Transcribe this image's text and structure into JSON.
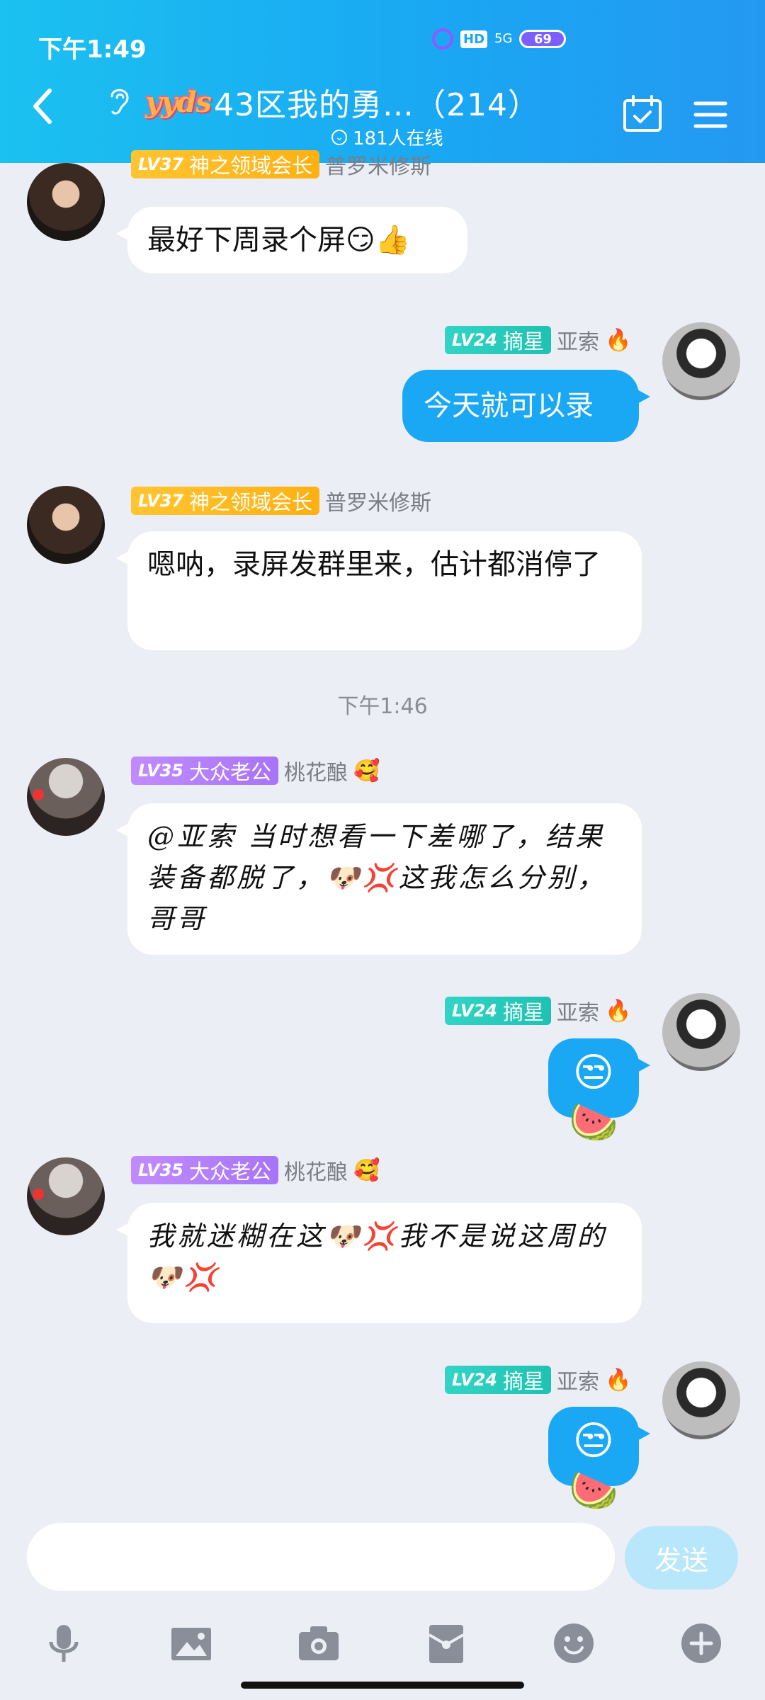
{
  "status": {
    "time": "下午1:49",
    "hd": "HD",
    "net": "5G",
    "battery": "69"
  },
  "header": {
    "logo_text": "yyds",
    "title": "43区我的勇…（214）",
    "online": "181人在线"
  },
  "messages": [
    {
      "side": "left",
      "badge_lv": "LV37",
      "badge_title": "神之领域会长",
      "name": "普罗米修斯",
      "text": "最好下周录个屏😏👍"
    },
    {
      "side": "right",
      "badge_lv": "LV24",
      "badge_title": "摘星",
      "name": "亚索",
      "name_emoji": "🔥",
      "text": "今天就可以录"
    },
    {
      "side": "left",
      "badge_lv": "LV37",
      "badge_title": "神之领域会长",
      "name": "普罗米修斯",
      "text": "嗯呐，录屏发群里来，估计都消停了"
    },
    {
      "timestamp": "下午1:46"
    },
    {
      "side": "left",
      "badge_lv": "LV35",
      "badge_title": "大众老公",
      "name": "桃花酿",
      "name_emoji": "🥰",
      "text": "@亚索 当时想看一下差哪了，结果装备都脱了，🐶💢这我怎么分别，哥哥"
    },
    {
      "side": "right",
      "badge_lv": "LV24",
      "badge_title": "摘星",
      "name": "亚索",
      "name_emoji": "🔥",
      "text": "😒🍉"
    },
    {
      "side": "left",
      "badge_lv": "LV35",
      "badge_title": "大众老公",
      "name": "桃花酿",
      "name_emoji": "🥰",
      "text": "我就迷糊在这🐶💢我不是说这周的🐶💢"
    },
    {
      "side": "right",
      "badge_lv": "LV24",
      "badge_title": "摘星",
      "name": "亚索",
      "name_emoji": "🔥",
      "text": "😒🍉"
    }
  ],
  "input": {
    "placeholder": "",
    "send_label": "发送"
  },
  "colors": {
    "header_start": "#1bc1f0",
    "header_end": "#2499f2",
    "bubble_self": "#1aa8f5",
    "background": "#eceef5"
  },
  "icons": [
    "back-arrow-icon",
    "ear-icon",
    "calendar-check-icon",
    "menu-icon",
    "microphone-icon",
    "image-icon",
    "camera-icon",
    "red-packet-icon",
    "emoji-icon",
    "plus-icon"
  ]
}
